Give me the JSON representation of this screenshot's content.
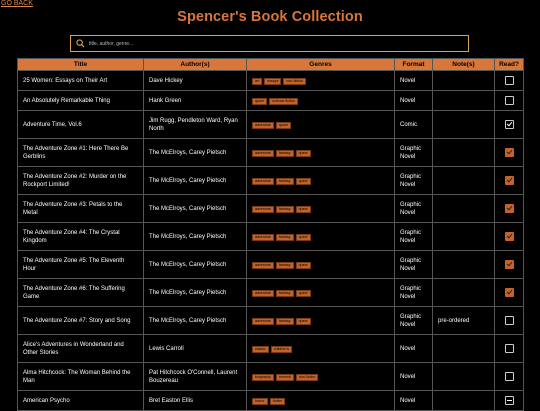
{
  "nav": {
    "go_back": "GO BACK"
  },
  "header": {
    "title": "Spencer's Book Collection"
  },
  "search": {
    "placeholder": "title, author, genre..."
  },
  "table": {
    "columns": [
      "Title",
      "Author(s)",
      "Genres",
      "Format",
      "Note(s)",
      "Read?"
    ],
    "rows": [
      {
        "title": "25 Women: Essays on Their Art",
        "authors": "Dave Hickey",
        "genres": [
          "art",
          "essays",
          "non-fiction"
        ],
        "format": "Novel",
        "notes": "",
        "read": "unchecked"
      },
      {
        "title": "An Absolutely Remarkable Thing",
        "authors": "Hank Green",
        "genres": [
          "queer",
          "science fiction"
        ],
        "format": "Novel",
        "notes": "",
        "read": "unchecked"
      },
      {
        "title": "Adventure Time, Vol.6",
        "authors": "Jim Rugg, Pendleton Ward, Ryan North",
        "genres": [
          "adventure",
          "queer"
        ],
        "format": "Comic",
        "notes": "",
        "read": "checked"
      },
      {
        "title": "The Adventure Zone #1: Here There Be Gerblins",
        "authors": "The McElroys, Carey Pietsch",
        "genres": [
          "adventure",
          "fantasy",
          "queer"
        ],
        "format": "Graphic Novel",
        "notes": "",
        "read": "checked-disabled"
      },
      {
        "title": "The Adventure Zone #2: Murder on the Rockport Limited!",
        "authors": "The McElroys, Carey Pietsch",
        "genres": [
          "adventure",
          "fantasy",
          "queer"
        ],
        "format": "Graphic Novel",
        "notes": "",
        "read": "checked-disabled"
      },
      {
        "title": "The Adventure Zone #3: Petals to the Metal",
        "authors": "The McElroys, Carey Pietsch",
        "genres": [
          "adventure",
          "fantasy",
          "queer"
        ],
        "format": "Graphic Novel",
        "notes": "",
        "read": "checked-disabled"
      },
      {
        "title": "The Adventure Zone #4: The Crystal Kingdom",
        "authors": "The McElroys, Carey Pietsch",
        "genres": [
          "adventure",
          "fantasy",
          "queer"
        ],
        "format": "Graphic Novel",
        "notes": "",
        "read": "checked-disabled"
      },
      {
        "title": "The Adventure Zone #5: The Eleventh Hour",
        "authors": "The McElroys, Carey Pietsch",
        "genres": [
          "adventure",
          "fantasy",
          "queer"
        ],
        "format": "Graphic Novel",
        "notes": "",
        "read": "checked-disabled"
      },
      {
        "title": "The Adventure Zone #6: The Suffering Game",
        "authors": "The McElroys, Carey Pietsch",
        "genres": [
          "adventure",
          "fantasy",
          "queer"
        ],
        "format": "Graphic Novel",
        "notes": "",
        "read": "checked-disabled"
      },
      {
        "title": "The Adventure Zone #7: Story and Song",
        "authors": "The McElroys, Carey Pietsch",
        "genres": [
          "adventure",
          "fantasy",
          "queer"
        ],
        "format": "Graphic Novel",
        "notes": "pre-ordered",
        "read": "unchecked"
      },
      {
        "title": "Alice's Adventures in Wonderland and Other Stories",
        "authors": "Lewis Carroll",
        "genres": [
          "classic",
          "children's"
        ],
        "format": "Novel",
        "notes": "",
        "read": "unchecked"
      },
      {
        "title": "Alma Hitchcock: The Woman Behind the Man",
        "authors": "Pat Hitchcock O'Connell, Laurent Bouzereau",
        "genres": [
          "biography",
          "memoir",
          "non-fiction"
        ],
        "format": "Novel",
        "notes": "",
        "read": "unchecked"
      },
      {
        "title": "American Psycho",
        "authors": "Bret Easton Ellis",
        "genres": [
          "horror",
          "thriller"
        ],
        "format": "Novel",
        "notes": "",
        "read": "indeterminate"
      }
    ]
  },
  "colors": {
    "accent": "#d9763a",
    "tag_bg": "#c1632b",
    "search_border": "#d9a441",
    "background": "#000000"
  }
}
